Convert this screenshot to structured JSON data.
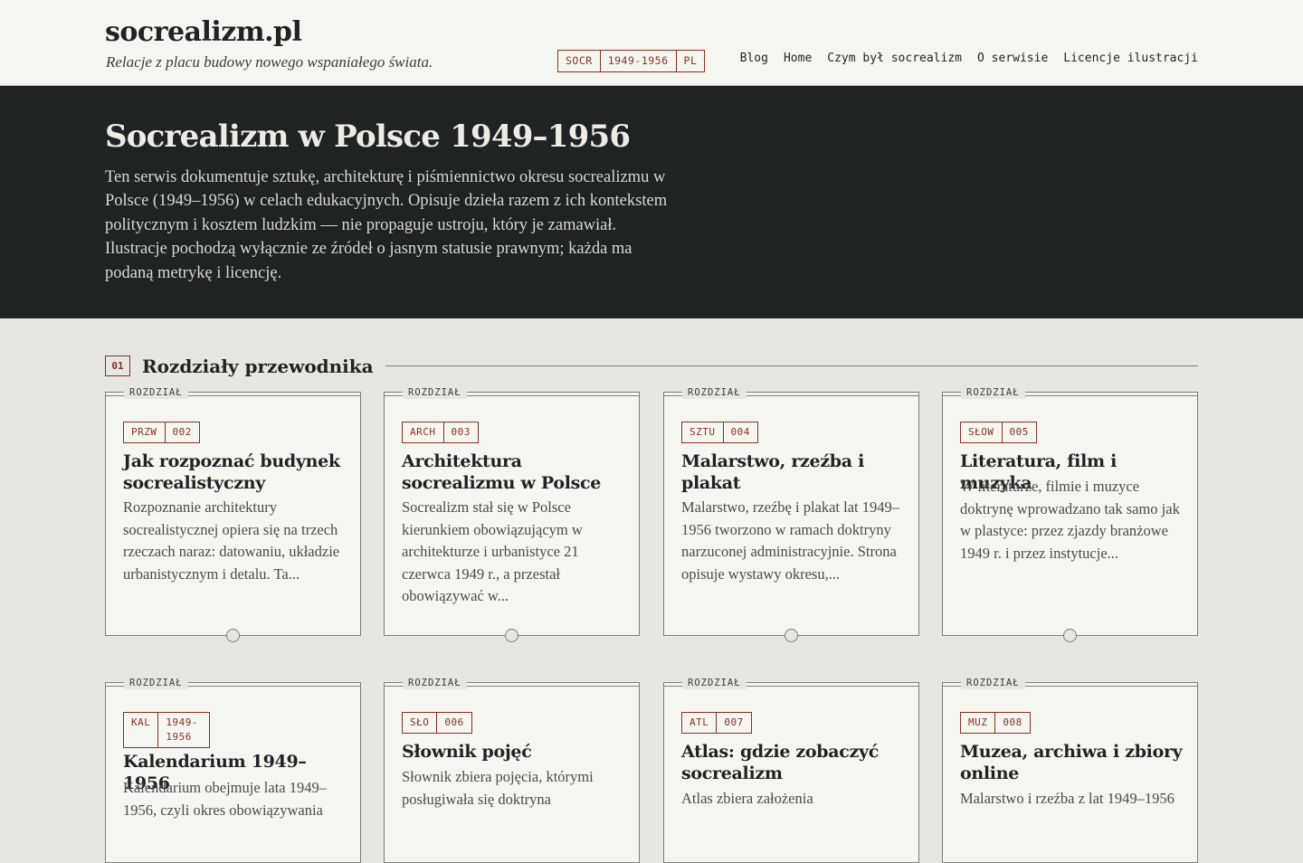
{
  "site": {
    "title": "socrealizm.pl",
    "tagline": "Relacje z placu budowy nowego wspaniałego świata."
  },
  "badges": [
    "SOCR",
    "1949-1956",
    "PL"
  ],
  "nav": [
    "Blog",
    "Home",
    "Czym był socrealizm",
    "O serwisie",
    "Licencje ilustracji"
  ],
  "hero": {
    "title": "Socrealizm w Polsce 1949–1956",
    "text": "Ten serwis dokumentuje sztukę, architekturę i piśmiennictwo okresu socrealizmu w Polsce (1949–1956) w celach edukacyjnych. Opisuje dzieła razem z ich kontekstem politycznym i kosztem ludzkim — nie propaguje ustroju, który je zamawiał. Ilustracje pochodzą wyłącznie ze źródeł o jasnym statusie prawnym; każda ma podaną metrykę i licencję."
  },
  "section": {
    "number": "01",
    "title": "Rozdziały przewodnika"
  },
  "cards": [
    {
      "kicker": "ROZDZIAŁ",
      "code": "PRZW",
      "num": "002",
      "title": "Jak rozpoznać budynek socrealistyczny",
      "text": "Rozpoznanie architektury socrealistycznej opiera się na trzech rzeczach naraz: datowaniu, układzie urbanistycznym i detalu. Ta..."
    },
    {
      "kicker": "ROZDZIAŁ",
      "code": "ARCH",
      "num": "003",
      "title": "Architektura socrealizmu w Polsce",
      "text": "Socrealizm stał się w Polsce kierunkiem obowiązującym w architekturze i urbanistyce 21 czerwca 1949 r., a przestał obowiązywać w..."
    },
    {
      "kicker": "ROZDZIAŁ",
      "code": "SZTU",
      "num": "004",
      "title": "Malarstwo, rzeźba i plakat",
      "text": "Malarstwo, rzeźbę i plakat lat 1949–1956 tworzono w ramach doktryny narzuconej administracyjnie. Strona opisuje wystawy okresu,..."
    },
    {
      "kicker": "ROZDZIAŁ",
      "code": "SŁOW",
      "num": "005",
      "title": "Literatura, film i muzyka",
      "text": "W literaturze, filmie i muzyce doktrynę wprowadzano tak samo jak w plastyce: przez zjazdy branżowe 1949 r. i przez instytucje..."
    },
    {
      "kicker": "ROZDZIAŁ",
      "code": "KAL",
      "num": "1949-1956",
      "title": "Kalendarium 1949–1956",
      "text": "Kalendarium obejmuje lata 1949–1956, czyli okres obowiązywania"
    },
    {
      "kicker": "ROZDZIAŁ",
      "code": "SŁO",
      "num": "006",
      "title": "Słownik pojęć",
      "text": "Słownik zbiera pojęcia, którymi posługiwała się doktryna"
    },
    {
      "kicker": "ROZDZIAŁ",
      "code": "ATL",
      "num": "007",
      "title": "Atlas: gdzie zobaczyć socrealizm",
      "text": "Atlas zbiera założenia"
    },
    {
      "kicker": "ROZDZIAŁ",
      "code": "MUZ",
      "num": "008",
      "title": "Muzea, archiwa i zbiory online",
      "text": "Malarstwo i rzeźba z lat 1949–1956"
    }
  ]
}
